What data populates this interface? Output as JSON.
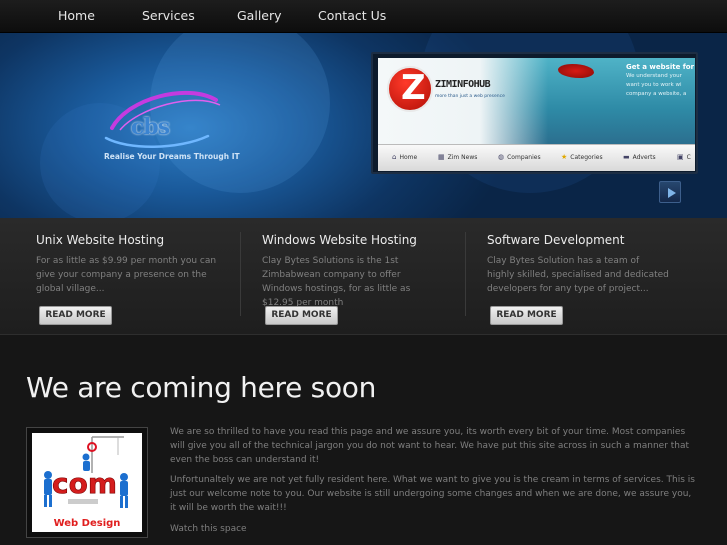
{
  "nav": {
    "items": [
      "Home",
      "Services",
      "Gallery",
      "Contact Us"
    ]
  },
  "hero": {
    "logo_text": "cbs",
    "tagline": "Realise Your Dreams Through IT",
    "preview": {
      "logo_letter": "Z",
      "brand": "ZIMINFOHUB",
      "brand_sub": "more than just a web presence",
      "headline": "Get a website for",
      "lines": [
        "We understand your",
        "want you to work wi",
        "company a website, a"
      ],
      "nav": [
        "Home",
        "Zim News",
        "Companies",
        "Categories",
        "Adverts",
        "C"
      ]
    }
  },
  "features": [
    {
      "title": "Unix Website Hosting",
      "desc": "For as little as $9.99 per month you can give your company a presence on the global village...",
      "button": "READ MORE"
    },
    {
      "title": "Windows Website Hosting",
      "desc": "Clay Bytes Solutions is the 1st Zimbabwean company to offer Windows hostings, for as little as $12.95 per month",
      "button": "READ MORE"
    },
    {
      "title": "Software Development",
      "desc": "Clay Bytes Solution has a team of highly skilled, specialised and dedicated developers for any type of project...",
      "button": "READ MORE"
    }
  ],
  "main": {
    "heading": "We are coming here soon",
    "image_label": "Web Design",
    "image_text": "com",
    "paragraphs": [
      "We are so thrilled to have you read this page and we assure you, its worth every bit of your time. Most companies will give you all of the technical jargon you do not want to hear. We have put this site across in such a manner that even the boss can understand it!",
      "Unfortunaltely we are not yet fully resident here. What we want to give you is the cream in terms of services. This is just our welcome note to you. Our website is still undergoing some changes and when we are done, we assure you, it will be worth the wait!!!",
      "Watch this space"
    ]
  }
}
